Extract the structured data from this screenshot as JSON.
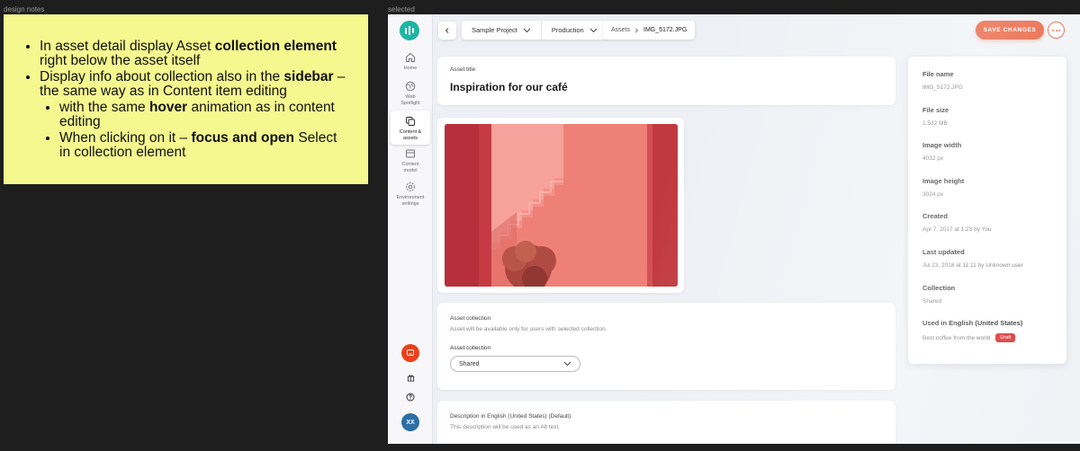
{
  "labels": {
    "notes": "design notes",
    "selected": "selected"
  },
  "notes": {
    "b1_pre": "In asset detail display Asset ",
    "b1_bold": "collection element",
    "b1_post": " right below the asset itself",
    "b2_pre": "Display info about collection also in the ",
    "b2_bold": "sidebar",
    "b2_post": " – the same way as in Content item editing",
    "s1_pre": "with the same ",
    "s1_bold": "hover",
    "s1_post": " animation as in content editing",
    "s2_pre": "When clicking on it – ",
    "s2_bold": "focus and open",
    "s2_post": " Select in collection element"
  },
  "nav": {
    "home": "Home",
    "web_spotlight": [
      "Web",
      "Spotlight"
    ],
    "content_assets": [
      "Content &",
      "assets"
    ],
    "content_model": [
      "Content",
      "model"
    ],
    "environment_settings": [
      "Environment",
      "settings"
    ],
    "avatar_initials": "XX"
  },
  "topbar": {
    "project": "Sample Project",
    "environment": "Production",
    "path_root": "Assets",
    "path_current": "IMG_5172.JPG",
    "save_label": "SAVE CHANGES"
  },
  "asset": {
    "title_label": "Asset title",
    "title_value": "Inspiration for our café"
  },
  "collection": {
    "section_label": "Asset collection",
    "hint": "Asset will be available only for users with selected collection.",
    "field_label": "Asset collection",
    "selected": "Shared"
  },
  "description": {
    "label": "Description in English (United States) (Default)",
    "hint": "This description will be used as an Alt text."
  },
  "info": {
    "file_name_label": "File name",
    "file_name": "IMG_5172.JPG",
    "file_size_label": "File size",
    "file_size": "1.532 MB",
    "width_label": "Image width",
    "width": "4032 px",
    "height_label": "Image height",
    "height": "3024 px",
    "created_label": "Created",
    "created": "Apr 7, 2017 at 1:23 by You",
    "updated_label": "Last updated",
    "updated": "Jul 23, 2018 at 11:11 by Unknown user",
    "collection_label": "Collection",
    "collection": "Shared",
    "used_label": "Used in English (United States)",
    "used_item": "Best coffee from the world",
    "used_status": "Draft"
  },
  "colors": {
    "accent": "#e4451e",
    "brand": "#1fb5a4",
    "draft": "#d6181b"
  }
}
